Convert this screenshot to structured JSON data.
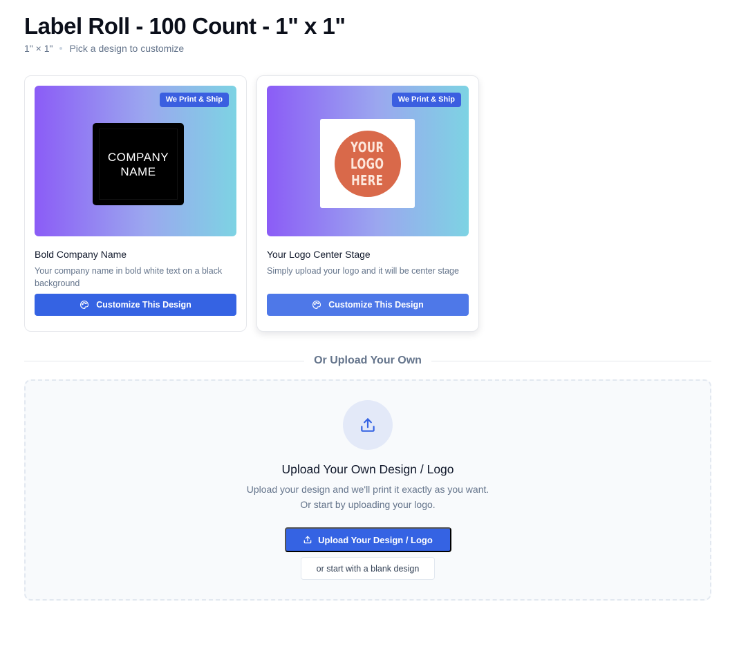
{
  "header": {
    "title": "Label Roll - 100 Count - 1\" x 1\"",
    "size": "1\" × 1\"",
    "hint": "Pick a design to customize"
  },
  "designs": [
    {
      "badge": "We Print & Ship",
      "preview_text": "COMPANY\nNAME",
      "title": "Bold Company Name",
      "description": "Your company name in bold white text on a black background",
      "button_label": "Customize This Design"
    },
    {
      "badge": "We Print & Ship",
      "preview_text": "YOUR\nLOGO\nHERE",
      "title": "Your Logo Center Stage",
      "description": "Simply upload your logo and it will be center stage",
      "button_label": "Customize This Design"
    }
  ],
  "divider": {
    "label": "Or Upload Your Own"
  },
  "upload": {
    "title": "Upload Your Own Design / Logo",
    "description_line1": "Upload your design and we'll print it exactly as you want.",
    "description_line2": "Or start by uploading your logo.",
    "button_label": "Upload Your Design / Logo",
    "blank_label": "or start with a blank design"
  },
  "icons": {
    "customize": "palette-icon",
    "upload": "upload-icon"
  },
  "colors": {
    "primary": "#3563e3",
    "badge": "#3b5fe0",
    "logo_circle": "#d9694a"
  }
}
